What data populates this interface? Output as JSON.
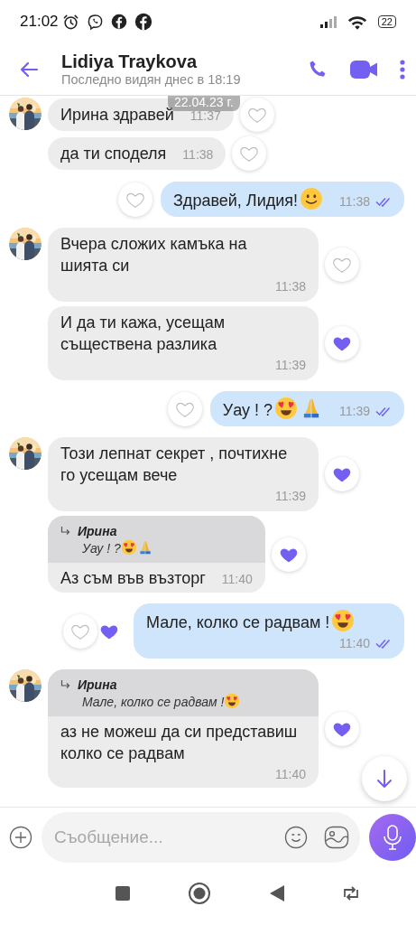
{
  "status_bar": {
    "time": "21:02",
    "battery": "22"
  },
  "header": {
    "name": "Lidiya Traykova",
    "subtitle": "Последно видян днес в 18:19"
  },
  "date_badge": "22.04.23 г.",
  "messages": [
    {
      "kind": "incoming",
      "avatar": true,
      "text": "Ирина здравей",
      "time": "11:37",
      "liked": false,
      "liked_by_contact": false
    },
    {
      "kind": "incoming",
      "avatar": false,
      "text": "да ти споделя",
      "time": "11:38",
      "liked": false,
      "liked_by_contact": false
    },
    {
      "kind": "outgoing",
      "text": "Здравей, Лидия!",
      "emoji": [
        {
          "kind": "slightly-smiling"
        }
      ],
      "time": "11:38",
      "read": true,
      "liked": false,
      "liked_by_contact": false
    },
    {
      "kind": "incoming",
      "avatar": true,
      "text": "Вчера сложих камъка на шията си",
      "time": "11:38",
      "liked": false,
      "liked_by_contact": false
    },
    {
      "kind": "incoming",
      "avatar": false,
      "text": "И да ти кажа, усещам съществена разлика",
      "time": "11:39",
      "liked": true,
      "liked_by_contact": false
    },
    {
      "kind": "outgoing",
      "text": "Уау ! ?",
      "emoji": [
        {
          "kind": "heart-eyes"
        },
        {
          "kind": "folded-hands"
        }
      ],
      "time": "11:39",
      "read": true,
      "liked": false,
      "liked_by_contact": false
    },
    {
      "kind": "incoming",
      "avatar": true,
      "text": "Този лепнат секрет , почтихне го усещам вече",
      "time": "11:39",
      "liked": true,
      "liked_by_contact": false
    },
    {
      "kind": "incoming",
      "avatar": false,
      "reply": {
        "author": "Ирина",
        "text": "Уау ! ?",
        "emoji": [
          {
            "kind": "heart-eyes"
          },
          {
            "kind": "folded-hands"
          }
        ]
      },
      "text": "Аз съм във възторг",
      "time": "11:40",
      "liked": true,
      "liked_by_contact": false
    },
    {
      "kind": "outgoing",
      "text": "Мале, колко се радвам !",
      "emoji": [
        {
          "kind": "heart-eyes"
        }
      ],
      "time": "11:40",
      "read": true,
      "liked": false,
      "liked_by_contact": true
    },
    {
      "kind": "incoming",
      "avatar": true,
      "reply": {
        "author": "Ирина",
        "text": "Мале, колко се радвам !",
        "emoji": [
          {
            "kind": "heart-eyes"
          }
        ]
      },
      "text": "аз не можеш да си представиш колко се радвам",
      "time": "11:40",
      "liked": true,
      "liked_by_contact": false
    }
  ],
  "composer": {
    "placeholder": "Съобщение..."
  }
}
